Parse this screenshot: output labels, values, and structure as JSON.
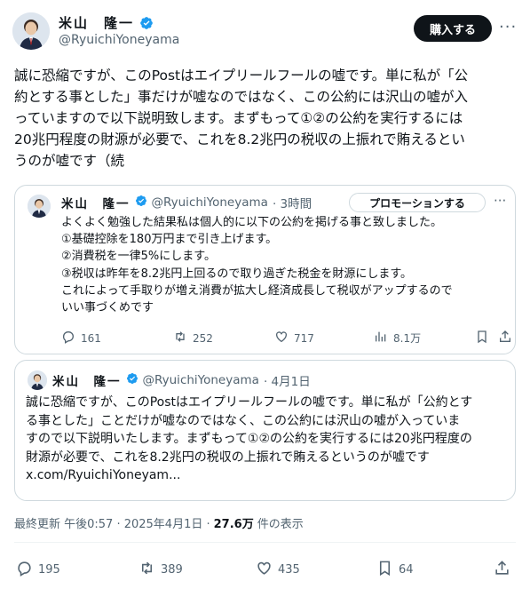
{
  "author": {
    "name": "米山　隆一",
    "handle": "@RyuichiYoneyama"
  },
  "header": {
    "buy_label": "購入する",
    "more_label": "···"
  },
  "post": {
    "text": "誠に恐縮ですが、このPostはエイプリールフールの嘘です。単に私が「公\n約とする事とした」事だけが嘘なのではなく、この公約には沢山の嘘が入\nっていますので以下説明致します。まずもって①②の公約を実行するには\n20兆円程度の財源が必要で、これを8.2兆円の税収の上振れで賄えるとい\nうのが嘘です（続"
  },
  "quote1": {
    "name": "米山　隆一",
    "handle": "@RyuichiYoneyama",
    "time": "· 3時間",
    "promo_label": "プロモーションする",
    "more_label": "···",
    "text": "よくよく勉強した結果私は個人的に以下の公約を掲げる事と致しました。\n①基礎控除を180万円まで引き上げます。\n②消費税を一律5%にします。\n③税収は昨年を8.2兆円上回るので取り過ぎた税金を財源にします。\nこれによって手取りが増え消費が拡大し経済成長して税収がアップするので\nいい事づくめです",
    "replies": "161",
    "reposts": "252",
    "likes": "717",
    "views": "8.1万"
  },
  "quote2": {
    "name": "米山　隆一",
    "handle": "@RyuichiYoneyama",
    "time": "· 4月1日",
    "text": "誠に恐縮ですが、このPostはエイプリールフールの嘘です。単に私が「公約とす\nる事とした」ことだけが嘘なのではなく、この公約には沢山の嘘が入っていま\nすので以下説明いたします。まずもって①②の公約を実行するには20兆円程度の\n財源が必要で、これを8.2兆円の税収の上振れで賄えるというのが嘘です\nx.com/RyuichiYoneyam..."
  },
  "footer": {
    "updated": "最終更新 午後0:57 · 2025年4月1日 ·",
    "views_count": "27.6万",
    "views_label": "件の表示"
  },
  "actions": {
    "replies": "195",
    "reposts": "389",
    "likes": "435",
    "bookmarks": "64"
  },
  "colors": {
    "text": "#0f1419",
    "secondary": "#536471",
    "border": "#cfd9de",
    "verified": "#1d9bf0"
  }
}
